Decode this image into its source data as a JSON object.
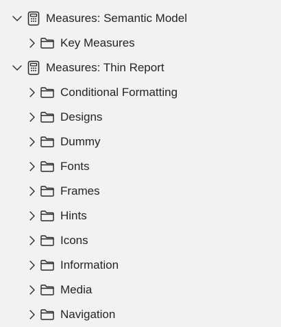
{
  "tree": {
    "tables": [
      {
        "label": "Measures: Semantic Model",
        "icon": "calculator-icon",
        "expanded": true,
        "folders": [
          {
            "label": "Key Measures",
            "icon": "folder-icon"
          }
        ]
      },
      {
        "label": "Measures: Thin Report",
        "icon": "calculator-icon",
        "expanded": true,
        "folders": [
          {
            "label": "Conditional Formatting",
            "icon": "folder-icon"
          },
          {
            "label": "Designs",
            "icon": "folder-icon"
          },
          {
            "label": "Dummy",
            "icon": "folder-icon"
          },
          {
            "label": "Fonts",
            "icon": "folder-icon"
          },
          {
            "label": "Frames",
            "icon": "folder-icon"
          },
          {
            "label": "Hints",
            "icon": "folder-icon"
          },
          {
            "label": "Icons",
            "icon": "folder-icon"
          },
          {
            "label": "Information",
            "icon": "folder-icon"
          },
          {
            "label": "Media",
            "icon": "folder-icon"
          },
          {
            "label": "Navigation",
            "icon": "folder-icon"
          }
        ]
      }
    ]
  }
}
